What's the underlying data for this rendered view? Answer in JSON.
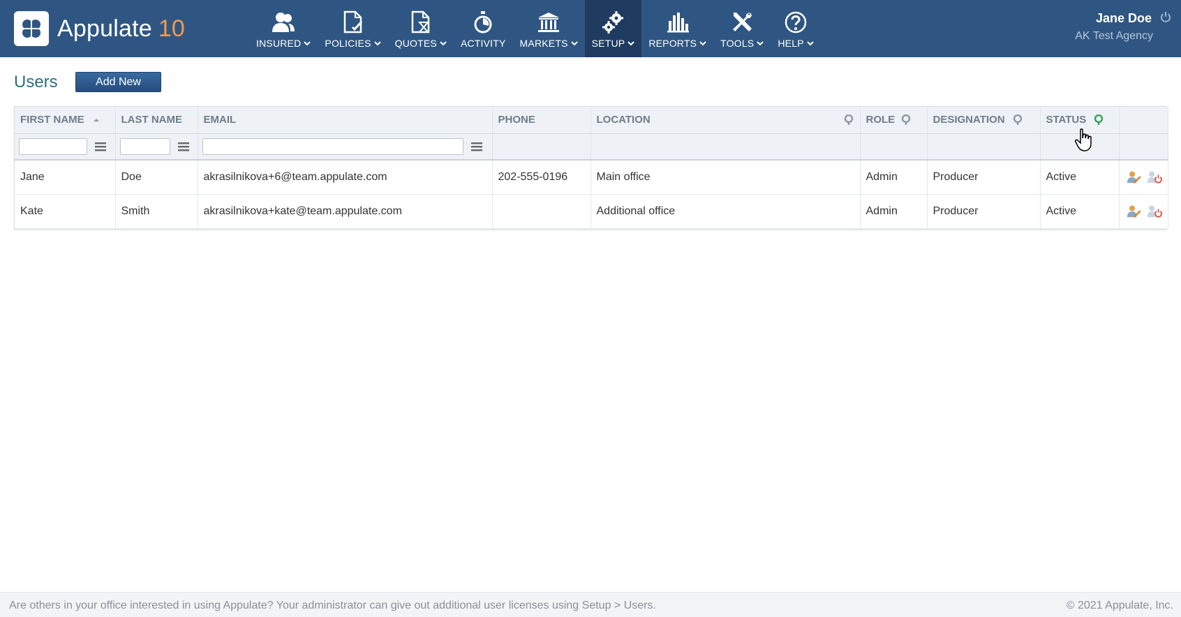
{
  "app": {
    "name": "Appulate",
    "version": "10"
  },
  "nav": [
    {
      "label": "INSURED",
      "icon": "insured-icon",
      "dropdown": true
    },
    {
      "label": "POLICIES",
      "icon": "policies-icon",
      "dropdown": true
    },
    {
      "label": "QUOTES",
      "icon": "quotes-icon",
      "dropdown": true
    },
    {
      "label": "ACTIVITY",
      "icon": "activity-icon",
      "dropdown": false
    },
    {
      "label": "MARKETS",
      "icon": "markets-icon",
      "dropdown": true
    },
    {
      "label": "SETUP",
      "icon": "setup-icon",
      "dropdown": true,
      "active": true
    },
    {
      "label": "REPORTS",
      "icon": "reports-icon",
      "dropdown": true
    },
    {
      "label": "TOOLS",
      "icon": "tools-icon",
      "dropdown": true
    },
    {
      "label": "HELP",
      "icon": "help-icon",
      "dropdown": true
    }
  ],
  "user": {
    "name": "Jane Doe",
    "agency": "AK Test Agency"
  },
  "page": {
    "title": "Users",
    "add_button": "Add New"
  },
  "grid": {
    "columns": [
      {
        "key": "first_name",
        "label": "FIRST NAME",
        "sorted": "asc",
        "filterable_text": true
      },
      {
        "key": "last_name",
        "label": "LAST NAME",
        "filterable_text": true
      },
      {
        "key": "email",
        "label": "EMAIL",
        "filterable_text": true
      },
      {
        "key": "phone",
        "label": "PHONE"
      },
      {
        "key": "location",
        "label": "LOCATION",
        "filter_icon": true
      },
      {
        "key": "role",
        "label": "ROLE",
        "filter_icon": true
      },
      {
        "key": "designation",
        "label": "DESIGNATION",
        "filter_icon": true
      },
      {
        "key": "status",
        "label": "STATUS",
        "filter_icon": true,
        "filter_active": true
      },
      {
        "key": "actions",
        "label": ""
      }
    ],
    "rows": [
      {
        "first_name": "Jane",
        "last_name": "Doe",
        "email": "akrasilnikova+6@team.appulate.com",
        "phone": "202-555-0196",
        "location": "Main office",
        "role": "Admin",
        "designation": "Producer",
        "status": "Active"
      },
      {
        "first_name": "Kate",
        "last_name": "Smith",
        "email": "akrasilnikova+kate@team.appulate.com",
        "phone": "",
        "location": "Additional office",
        "role": "Admin",
        "designation": "Producer",
        "status": "Active"
      }
    ]
  },
  "footer": {
    "message": "Are others in your office interested in using Appulate? Your administrator can give out additional user licenses using Setup > Users.",
    "copyright": "© 2021 Appulate, Inc."
  },
  "colors": {
    "header_bg": "#2f5682",
    "header_active": "#1f3c60",
    "accent_orange": "#f39a4e",
    "title_teal": "#2c6f7e",
    "filter_active_green": "#3aa35b"
  }
}
